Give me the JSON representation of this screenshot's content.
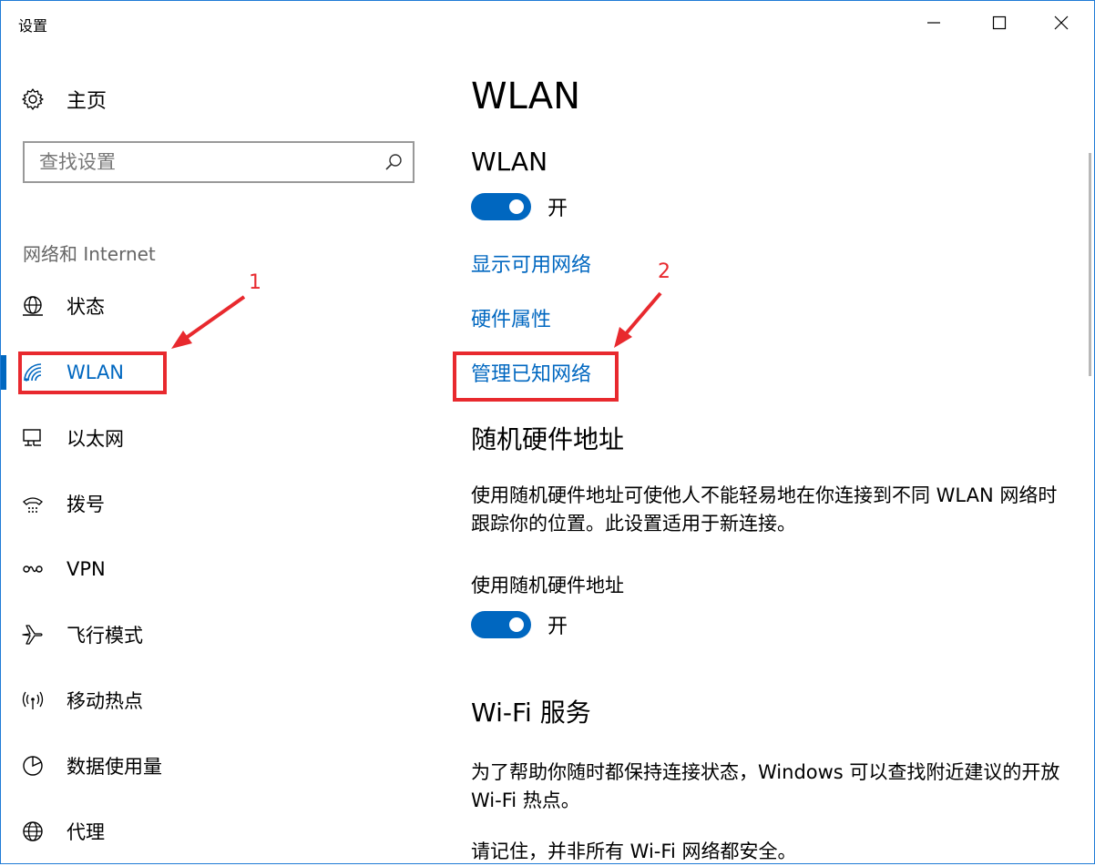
{
  "window": {
    "title": "设置"
  },
  "sidebar": {
    "home_label": "主页",
    "search_placeholder": "查找设置",
    "section_header": "网络和 Internet",
    "items": [
      {
        "label": "状态",
        "icon": "globe-status-icon"
      },
      {
        "label": "WLAN",
        "icon": "wifi-icon",
        "active": true
      },
      {
        "label": "以太网",
        "icon": "ethernet-icon"
      },
      {
        "label": "拨号",
        "icon": "dialup-icon"
      },
      {
        "label": "VPN",
        "icon": "vpn-icon"
      },
      {
        "label": "飞行模式",
        "icon": "airplane-icon"
      },
      {
        "label": "移动热点",
        "icon": "hotspot-icon"
      },
      {
        "label": "数据使用量",
        "icon": "data-usage-icon"
      },
      {
        "label": "代理",
        "icon": "proxy-globe-icon"
      }
    ]
  },
  "main": {
    "page_title": "WLAN",
    "wlan_section_title": "WLAN",
    "wlan_toggle_state": "开",
    "links": {
      "show_available": "显示可用网络",
      "hardware_props": "硬件属性",
      "manage_known": "管理已知网络"
    },
    "random_hw": {
      "title": "随机硬件地址",
      "description": "使用随机硬件地址可使他人不能轻易地在你连接到不同 WLAN 网络时跟踪你的位置。此设置适用于新连接。",
      "field_label": "使用随机硬件地址",
      "toggle_state": "开"
    },
    "wifi_service": {
      "title": "Wi-Fi 服务",
      "description": "为了帮助你随时都保持连接状态，Windows 可以查找附近建议的开放 Wi-Fi 热点。",
      "note": "请记住，并非所有 Wi-Fi 网络都安全。"
    }
  },
  "annotations": {
    "marker_1": "1",
    "marker_2": "2"
  },
  "colors": {
    "accent": "#0067c0",
    "annotation": "#e8292e",
    "window_border": "#1e7bd6"
  }
}
